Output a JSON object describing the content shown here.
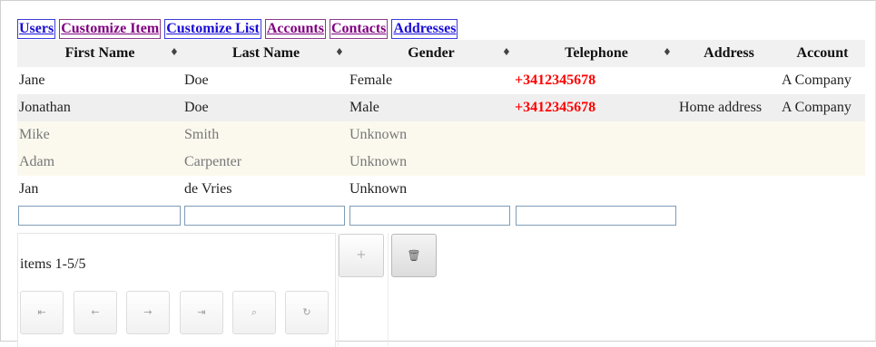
{
  "tabs": [
    {
      "label": "Users",
      "color": "#1a0dd6"
    },
    {
      "label": "Customize Item",
      "color": "#800080"
    },
    {
      "label": "Customize List",
      "color": "#1a0dd6"
    },
    {
      "label": "Accounts",
      "color": "#800080"
    },
    {
      "label": "Contacts",
      "color": "#800080"
    },
    {
      "label": "Addresses",
      "color": "#1a0dd6"
    }
  ],
  "table": {
    "columns": [
      "First Name",
      "Last Name",
      "Gender",
      "Telephone",
      "Address",
      "Account"
    ],
    "rows": [
      {
        "first": "Jane",
        "last": "Doe",
        "gender": "Female",
        "phone": "+3412345678",
        "address": "",
        "account": "A Company"
      },
      {
        "first": "Jonathan",
        "last": "Doe",
        "gender": "Male",
        "phone": "+3412345678",
        "address": "Home address",
        "account": "A Company"
      },
      {
        "first": "Mike",
        "last": "Smith",
        "gender": "Unknown",
        "phone": "",
        "address": "",
        "account": ""
      },
      {
        "first": "Adam",
        "last": "Carpenter",
        "gender": "Unknown",
        "phone": "",
        "address": "",
        "account": ""
      },
      {
        "first": "Jan",
        "last": "de Vries",
        "gender": "Unknown",
        "phone": "",
        "address": "",
        "account": ""
      }
    ],
    "phone_color": "#ff0000"
  },
  "pager": {
    "info": "items 1-5/5",
    "buttons": [
      "first-page-icon",
      "prev-page-icon",
      "next-page-icon",
      "last-page-icon",
      "search-icon",
      "refresh-icon"
    ],
    "glyphs": {
      "first": "⇤",
      "prev": "←",
      "next": "→",
      "last": "⇥",
      "search": "⌕",
      "refresh": "↻"
    }
  },
  "actions": {
    "add_glyph": "+",
    "delete_glyph": "🗑"
  }
}
